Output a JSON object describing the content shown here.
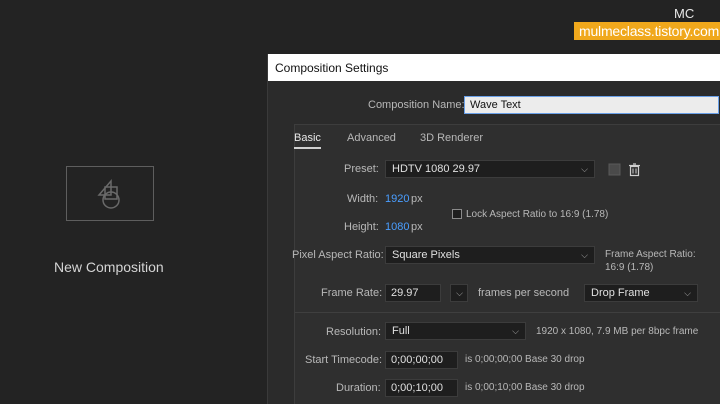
{
  "background": {
    "new_composition_label": "New Composition"
  },
  "watermark": {
    "text": "mulmeclass.tistory.com",
    "mark": "MC"
  },
  "dialog": {
    "title": "Composition Settings",
    "comp_name_label": "Composition Name:",
    "comp_name_value": "Wave Text",
    "tabs": [
      "Basic",
      "Advanced",
      "3D Renderer"
    ],
    "preset_label": "Preset:",
    "preset_value": "HDTV 1080 29.97",
    "width_label": "Width:",
    "width_value": "1920",
    "width_unit": "px",
    "height_label": "Height:",
    "height_value": "1080",
    "height_unit": "px",
    "lock_aspect_label": "Lock Aspect Ratio to 16:9 (1.78)",
    "lock_aspect_checked": false,
    "pixel_aspect_label": "Pixel Aspect Ratio:",
    "pixel_aspect_value": "Square Pixels",
    "frame_aspect_label": "Frame Aspect Ratio:",
    "frame_aspect_value": "16:9 (1.78)",
    "frame_rate_label": "Frame Rate:",
    "frame_rate_value": "29.97",
    "frames_per_second": "frames per second",
    "drop_frame_value": "Drop Frame",
    "resolution_label": "Resolution:",
    "resolution_value": "Full",
    "resolution_info": "1920 x 1080, 7.9 MB per 8bpc frame",
    "start_tc_label": "Start Timecode:",
    "start_tc_value": "0;00;00;00",
    "start_tc_info": "is 0;00;00;00  Base 30  drop",
    "duration_label": "Duration:",
    "duration_value": "0;00;10;00",
    "duration_info": "is 0;00;10;00  Base 30  drop"
  },
  "colors": {
    "accent_blue": "#4a9eff",
    "watermark_bg": "#f0a81c"
  }
}
